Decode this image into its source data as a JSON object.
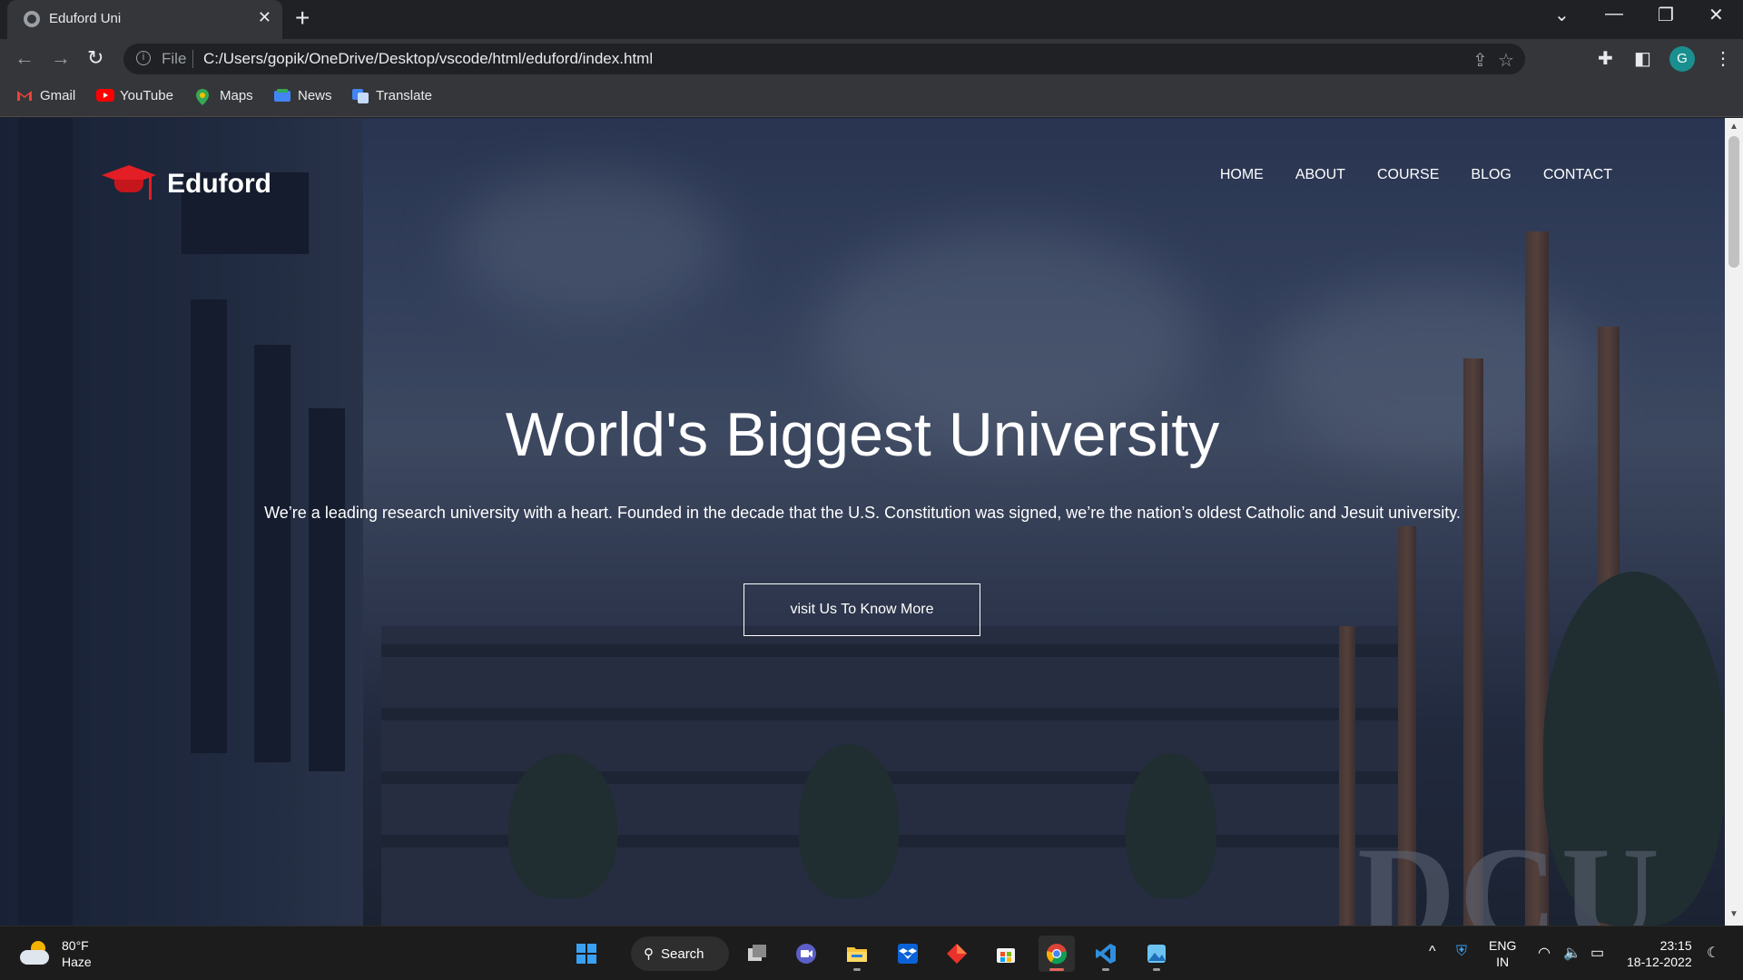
{
  "browser": {
    "tab_title": "Eduford Uni",
    "new_tab_label": "+",
    "address_label": "File",
    "url": "C:/Users/gopik/OneDrive/Desktop/vscode/html/eduford/index.html",
    "profile_initial": "G",
    "bookmarks": [
      {
        "label": "Gmail",
        "icon": "gmail-icon",
        "color": "#ea4335"
      },
      {
        "label": "YouTube",
        "icon": "youtube-icon",
        "color": "#ff0000"
      },
      {
        "label": "Maps",
        "icon": "maps-icon",
        "color": "#34a853"
      },
      {
        "label": "News",
        "icon": "news-icon",
        "color": "#4285f4"
      },
      {
        "label": "Translate",
        "icon": "translate-icon",
        "color": "#4285f4"
      }
    ]
  },
  "site": {
    "brand": "Eduford",
    "brand_color": "#e31e24",
    "nav": [
      "HOME",
      "ABOUT",
      "COURSE",
      "BLOG",
      "CONTACT"
    ],
    "hero_title": "World's Biggest University",
    "hero_subtitle": "We’re a leading research university with a heart. Founded in the decade that the U.S. Constitution was signed, we’re the nation’s oldest Catholic and Jesuit university.",
    "hero_button": "visit Us To Know More",
    "background_sign": "DCU"
  },
  "taskbar": {
    "weather_temp": "80°F",
    "weather_desc": "Haze",
    "search_label": "Search",
    "lang_1": "ENG",
    "lang_2": "IN",
    "time": "23:15",
    "date": "18-12-2022"
  }
}
